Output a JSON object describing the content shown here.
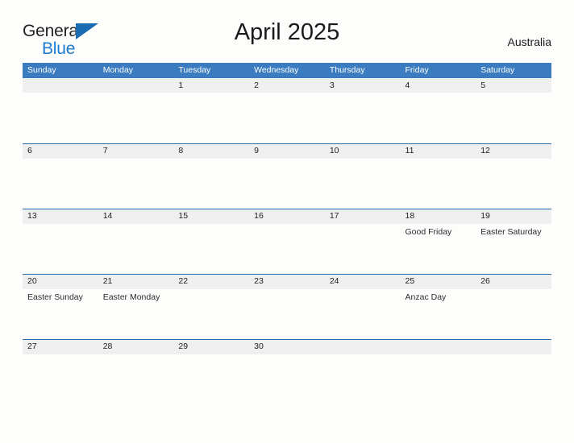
{
  "brand": {
    "name_part1": "General",
    "name_part2": "Blue",
    "triangle_color": "#1c6cb4",
    "text_color_part1": "#231f20",
    "text_color_part2": "#1c7bd0"
  },
  "header": {
    "title": "April 2025",
    "country": "Australia"
  },
  "theme": {
    "header_blue": "#3b7cc0",
    "band_gray": "#efefef",
    "band_border_blue": "#2a6eb0",
    "page_background": "#fdfdfc",
    "text_color": "#222222"
  },
  "calendar": {
    "weekdays": [
      "Sunday",
      "Monday",
      "Tuesday",
      "Wednesday",
      "Thursday",
      "Friday",
      "Saturday"
    ],
    "weeks": [
      [
        {
          "day": "",
          "event": ""
        },
        {
          "day": "",
          "event": ""
        },
        {
          "day": "1",
          "event": ""
        },
        {
          "day": "2",
          "event": ""
        },
        {
          "day": "3",
          "event": ""
        },
        {
          "day": "4",
          "event": ""
        },
        {
          "day": "5",
          "event": ""
        }
      ],
      [
        {
          "day": "6",
          "event": ""
        },
        {
          "day": "7",
          "event": ""
        },
        {
          "day": "8",
          "event": ""
        },
        {
          "day": "9",
          "event": ""
        },
        {
          "day": "10",
          "event": ""
        },
        {
          "day": "11",
          "event": ""
        },
        {
          "day": "12",
          "event": ""
        }
      ],
      [
        {
          "day": "13",
          "event": ""
        },
        {
          "day": "14",
          "event": ""
        },
        {
          "day": "15",
          "event": ""
        },
        {
          "day": "16",
          "event": ""
        },
        {
          "day": "17",
          "event": ""
        },
        {
          "day": "18",
          "event": "Good Friday"
        },
        {
          "day": "19",
          "event": "Easter Saturday"
        }
      ],
      [
        {
          "day": "20",
          "event": "Easter Sunday"
        },
        {
          "day": "21",
          "event": "Easter Monday"
        },
        {
          "day": "22",
          "event": ""
        },
        {
          "day": "23",
          "event": ""
        },
        {
          "day": "24",
          "event": ""
        },
        {
          "day": "25",
          "event": "Anzac Day"
        },
        {
          "day": "26",
          "event": ""
        }
      ],
      [
        {
          "day": "27",
          "event": ""
        },
        {
          "day": "28",
          "event": ""
        },
        {
          "day": "29",
          "event": ""
        },
        {
          "day": "30",
          "event": ""
        },
        {
          "day": "",
          "event": ""
        },
        {
          "day": "",
          "event": ""
        },
        {
          "day": "",
          "event": ""
        }
      ]
    ]
  }
}
